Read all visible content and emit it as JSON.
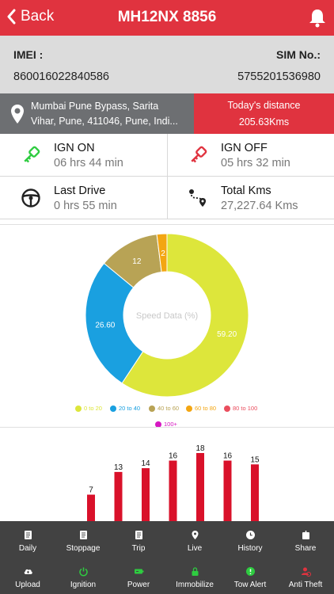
{
  "header": {
    "back_label": "Back",
    "title": "MH12NX 8856"
  },
  "vehicle_info": {
    "imei_label": "IMEI :",
    "imei_value": "860016022840586",
    "sim_label": "SIM No.:",
    "sim_value": "5755201536980"
  },
  "address": {
    "line1": "Mumbai Pune Bypass, Sarita",
    "line2": "Vihar, Pune, 411046, Pune, Indi..."
  },
  "todays_distance": {
    "label": "Today's distance",
    "value": "205.63Kms"
  },
  "stats": [
    {
      "title": "IGN ON",
      "value": "06 hrs 44 min",
      "icon": "green-key-icon"
    },
    {
      "title": "IGN OFF",
      "value": "05 hrs 32 min",
      "icon": "red-key-icon"
    },
    {
      "title": "Last Drive",
      "value": "0 hrs 55 min",
      "icon": "steering-wheel-icon"
    },
    {
      "title": "Total Kms",
      "value": "27,227.64 Kms",
      "icon": "route-icon"
    }
  ],
  "chart_data": [
    {
      "type": "pie",
      "center_label": "Speed Data (%)",
      "categories": [
        "0 to 20",
        "20 to 40",
        "40 to 60",
        "60 to 80",
        "80 to 100",
        "100+"
      ],
      "values": [
        59.2,
        26.6,
        12,
        2,
        0,
        0
      ],
      "value_labels": [
        "59.20",
        "26.60",
        "12",
        "2",
        "",
        ""
      ],
      "colors": [
        "#dde63b",
        "#1aa0e0",
        "#b8a355",
        "#f3a612",
        "#ea4e5e",
        "#d617c2"
      ],
      "legend_placement": "bottom"
    },
    {
      "type": "bar",
      "values": [
        7,
        13,
        14,
        16,
        18,
        16,
        15
      ],
      "color": "#d9112a"
    }
  ],
  "bottom_nav": {
    "row1": [
      {
        "label": "Daily",
        "icon": "document-icon"
      },
      {
        "label": "Stoppage",
        "icon": "document-icon"
      },
      {
        "label": "Trip",
        "icon": "document-icon"
      },
      {
        "label": "Live",
        "icon": "location-pin-icon"
      },
      {
        "label": "History",
        "icon": "clock-icon"
      },
      {
        "label": "Share",
        "icon": "share-icon"
      }
    ],
    "row2": [
      {
        "label": "Upload",
        "icon": "cloud-upload-icon"
      },
      {
        "label": "Ignition",
        "icon": "power-icon"
      },
      {
        "label": "Power",
        "icon": "battery-icon"
      },
      {
        "label": "Immobilize",
        "icon": "lock-icon"
      },
      {
        "label": "Tow Alert",
        "icon": "alert-icon"
      },
      {
        "label": "Anti Theft",
        "icon": "anti-theft-icon"
      }
    ]
  },
  "colors": {
    "brand_red": "#e0333f",
    "grey_panel": "#6d6f72",
    "nav_bg": "#424242",
    "green_icon": "#2ecc40"
  }
}
